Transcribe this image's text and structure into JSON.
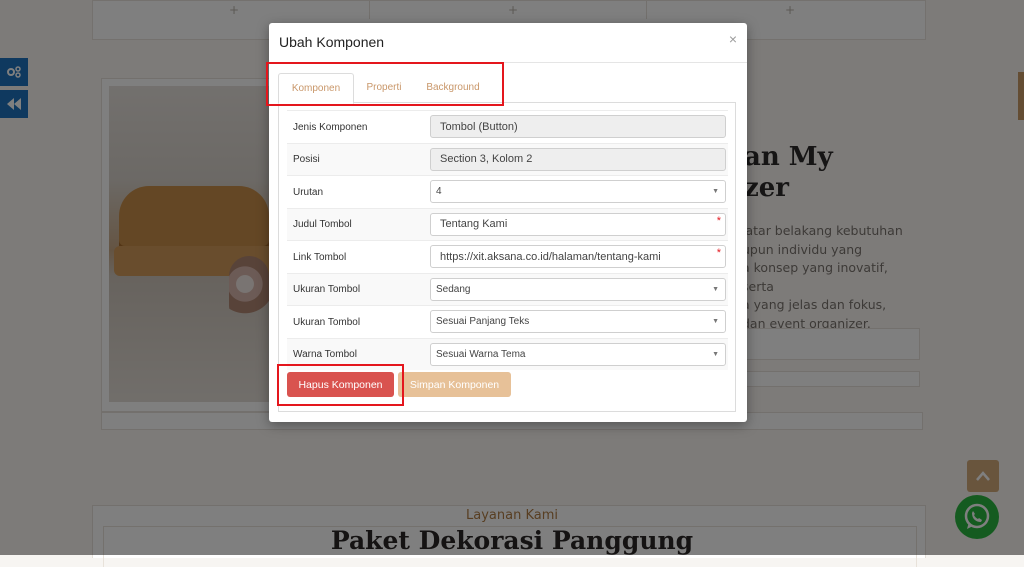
{
  "background": {
    "about_heading_line1": "an My",
    "about_heading_line2": "zer",
    "about_text": [
      "latar belakang kebutuhan",
      "upun individu yang",
      "a konsep yang inovatif, serta",
      "a yang jelas dan fokus,",
      "dan event organizer."
    ],
    "section_subtitle": "Layanan Kami",
    "section_title": "Paket Dekorasi Panggung"
  },
  "modal": {
    "title": "Ubah Komponen",
    "close_label": "×",
    "tabs": [
      {
        "label": "Komponen",
        "active": true
      },
      {
        "label": "Properti",
        "active": false
      },
      {
        "label": "Background",
        "active": false
      }
    ],
    "fields": [
      {
        "label": "Jenis Komponen",
        "value": "Tombol (Button)",
        "type": "readonly"
      },
      {
        "label": "Posisi",
        "value": "Section 3, Kolom 2",
        "type": "readonly"
      },
      {
        "label": "Urutan",
        "value": "4",
        "type": "select"
      },
      {
        "label": "Judul Tombol",
        "value": "Tentang Kami",
        "type": "text",
        "required": true
      },
      {
        "label": "Link Tombol",
        "value": "https://xit.aksana.co.id/halaman/tentang-kami",
        "type": "text",
        "required": true
      },
      {
        "label": "Ukuran Tombol",
        "value": "Sedang",
        "type": "select"
      },
      {
        "label": "Ukuran Tombol",
        "value": "Sesuai Panjang Teks",
        "type": "select"
      },
      {
        "label": "Warna Tombol",
        "value": "Sesuai Warna Tema",
        "type": "select"
      }
    ],
    "required_mark": "*",
    "delete_button": "Hapus Komponen",
    "save_button": "Simpan Komponen"
  },
  "icons": {
    "plus": "+",
    "scroll_top": "chevron-up-icon",
    "whatsapp": "whatsapp-icon",
    "settings": "gears-icon",
    "back": "backward-icon"
  },
  "colors": {
    "accent": "#c9976a",
    "danger": "#d9534f",
    "save": "#e7c198",
    "highlight": "#e4161d",
    "side_button": "#1e73be"
  }
}
